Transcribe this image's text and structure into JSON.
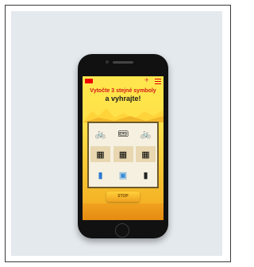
{
  "promo": {
    "headline_line1": "Vytočte 3 stejné symboly",
    "headline_line2": "a vyhrajte!",
    "stop_label": "STOP"
  },
  "reels": [
    {
      "symbols": [
        "bicycle-icon",
        "ticket-icon",
        "bicycle-icon"
      ]
    },
    {
      "symbols": [
        "product-box-icon",
        "product-box-icon",
        "product-box-icon"
      ]
    },
    {
      "symbols": [
        "bottle-icon",
        "pack-icon",
        "fridge-icon"
      ]
    }
  ],
  "colors": {
    "headline": "#d31a1a",
    "background": "#ffe64f",
    "frame": "#6e5a2a",
    "stop_button": "#f0a020"
  }
}
